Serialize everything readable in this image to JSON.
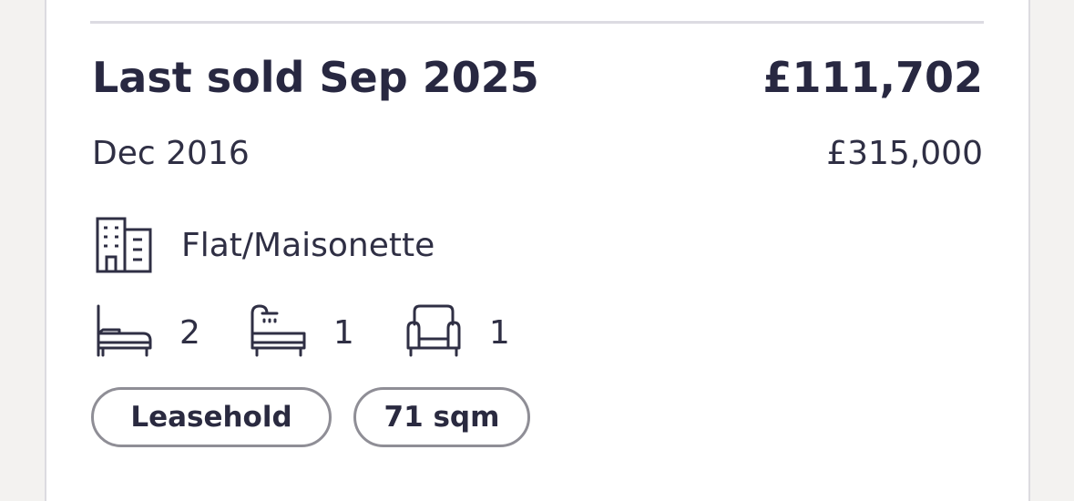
{
  "sale": {
    "title": "Last sold Sep 2025",
    "price": "£111,702"
  },
  "previous_sale": {
    "date": "Dec 2016",
    "price": "£315,000"
  },
  "property": {
    "type_icon": "building-icon",
    "type": "Flat/Maisonette",
    "features": [
      {
        "icon": "bed-icon",
        "value": "2"
      },
      {
        "icon": "bath-icon",
        "value": "1"
      },
      {
        "icon": "armchair-icon",
        "value": "1"
      }
    ]
  },
  "tags": {
    "tenure": "Leasehold",
    "size": "71 sqm"
  },
  "colors": {
    "text": "#282841",
    "border": "#8f8e96",
    "divider": "#dcdbe2",
    "background": "#f3f2f0",
    "card": "#ffffff"
  }
}
